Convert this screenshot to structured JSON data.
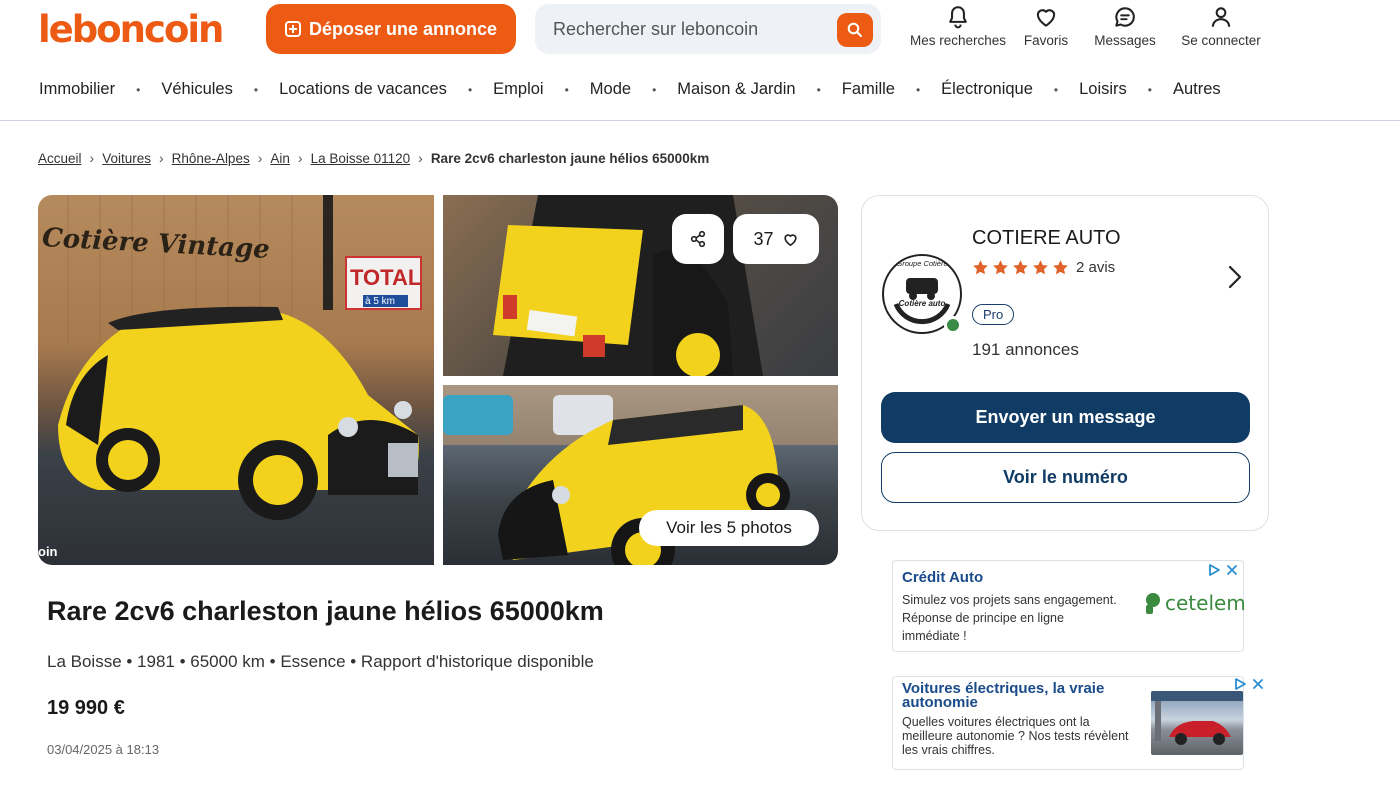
{
  "header": {
    "logo": "leboncoin",
    "deposit_label": "Déposer une annonce",
    "search_placeholder": "Rechercher sur leboncoin",
    "icons": [
      {
        "label": "Mes recherches",
        "icon": "bell-icon"
      },
      {
        "label": "Favoris",
        "icon": "heart-icon"
      },
      {
        "label": "Messages",
        "icon": "chat-icon"
      },
      {
        "label": "Se connecter",
        "icon": "user-icon"
      }
    ]
  },
  "categories": [
    "Immobilier",
    "Véhicules",
    "Locations de vacances",
    "Emploi",
    "Mode",
    "Maison & Jardin",
    "Famille",
    "Électronique",
    "Loisirs",
    "Autres"
  ],
  "breadcrumb": {
    "items": [
      "Accueil",
      "Voitures",
      "Rhône-Alpes",
      "Ain",
      "La Boisse 01120"
    ],
    "current": "Rare 2cv6 charleston jaune hélios 65000km"
  },
  "gallery": {
    "favorites_count": "37",
    "photos_label": "Voir les 5 photos",
    "watermark": "oin",
    "main_sign": "Cotière Vintage",
    "total_sign": "TOTAL",
    "total_sub": "à 5 km"
  },
  "listing": {
    "title": "Rare 2cv6 charleston jaune hélios 65000km",
    "attributes": "La Boisse • 1981 • 65000 km • Essence • Rapport d'historique disponible",
    "price": "19 990 €",
    "date": "03/04/2025 à 18:13"
  },
  "seller": {
    "name": "COTIERE AUTO",
    "rating": 5,
    "reviews": "2 avis",
    "badge": "Pro",
    "listings": "191 annonces",
    "message_label": "Envoyer un message",
    "number_label": "Voir le numéro",
    "logo_top": "Groupe Cotière",
    "logo_bottom": "Cotière auto"
  },
  "ads": [
    {
      "title": "Crédit Auto",
      "body": "Simulez vos projets sans engagement. Réponse de principe en ligne immédiate !",
      "brand": "cetelem"
    },
    {
      "title": "Voitures électriques, la vraie autonomie",
      "body": "Quelles voitures électriques ont la meilleure autonomie ? Nos tests révèlent les vrais chiffres."
    }
  ],
  "colors": {
    "brand_orange": "#ec5a13",
    "primary_blue": "#0f3b65",
    "star": "#e0632b",
    "online": "#3a8a48"
  }
}
